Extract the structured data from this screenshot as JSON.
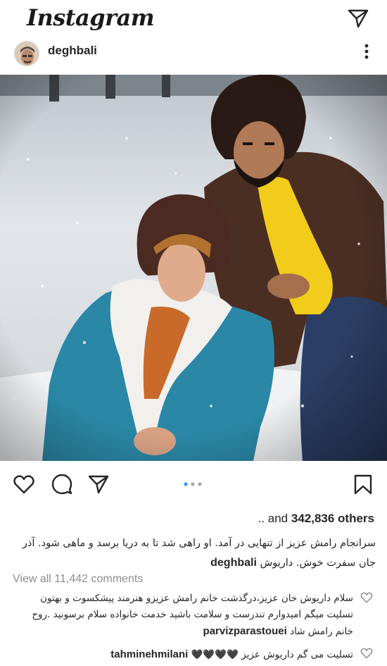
{
  "app": {
    "logo_text": "Instagram"
  },
  "post": {
    "username": "deghbali",
    "likes_prefix": ".. and ",
    "likes_count": "342,836",
    "likes_suffix": " others",
    "caption_user": "deghbali",
    "caption_text": "سرانجام رامش عزیز از تنهایی در آمد. او راهی شد تا به دریا برسد و ماهی شود. آذر جان سفرت خوش. داریوش",
    "view_all": "View all 11,442 comments",
    "carousel_dots": 3,
    "carousel_active": 0
  },
  "comments": [
    {
      "user": "parvizparastouei",
      "text": "سلام داریوش خان عزیز،درگذشت خانم رامش عزیزو هنرمند پیشکسوت و بهتون تسلیت میگم امیدوارم تندرست و سلامت باشید خدمت خانواده سلام برسونید .روح خانم رامش شاد"
    },
    {
      "user": "tahminehmilani",
      "text": "تسلیت می گم داریوش عزیز 🖤🖤🖤🖤"
    }
  ],
  "icons": {
    "direct": "paper-plane-icon",
    "more": "more-vertical-icon",
    "like": "heart-icon",
    "comment": "comment-bubble-icon",
    "share": "share-plane-icon",
    "save": "bookmark-icon"
  },
  "colors": {
    "text": "#262626",
    "muted": "#8e8e8e",
    "accent": "#3897f0"
  }
}
